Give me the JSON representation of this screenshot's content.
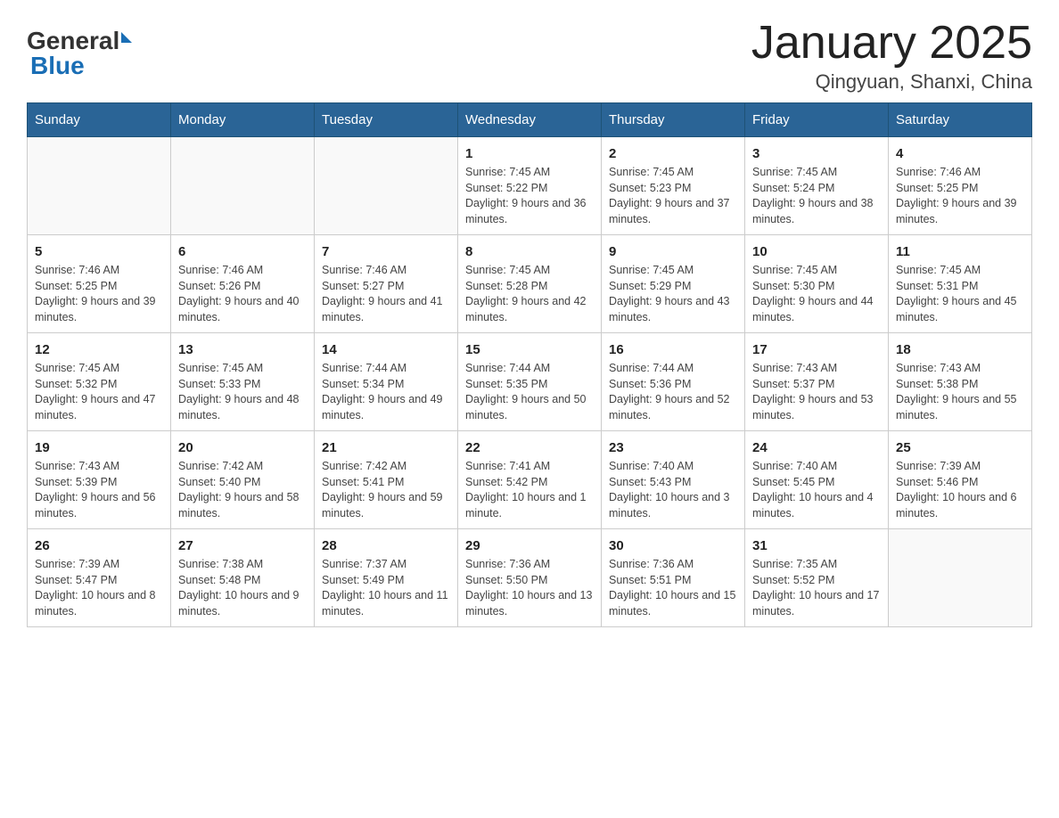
{
  "header": {
    "logo_general": "General",
    "logo_blue": "Blue",
    "month_title": "January 2025",
    "location": "Qingyuan, Shanxi, China"
  },
  "days_of_week": [
    "Sunday",
    "Monday",
    "Tuesday",
    "Wednesday",
    "Thursday",
    "Friday",
    "Saturday"
  ],
  "weeks": [
    [
      {
        "day": "",
        "info": ""
      },
      {
        "day": "",
        "info": ""
      },
      {
        "day": "",
        "info": ""
      },
      {
        "day": "1",
        "info": "Sunrise: 7:45 AM\nSunset: 5:22 PM\nDaylight: 9 hours and 36 minutes."
      },
      {
        "day": "2",
        "info": "Sunrise: 7:45 AM\nSunset: 5:23 PM\nDaylight: 9 hours and 37 minutes."
      },
      {
        "day": "3",
        "info": "Sunrise: 7:45 AM\nSunset: 5:24 PM\nDaylight: 9 hours and 38 minutes."
      },
      {
        "day": "4",
        "info": "Sunrise: 7:46 AM\nSunset: 5:25 PM\nDaylight: 9 hours and 39 minutes."
      }
    ],
    [
      {
        "day": "5",
        "info": "Sunrise: 7:46 AM\nSunset: 5:25 PM\nDaylight: 9 hours and 39 minutes."
      },
      {
        "day": "6",
        "info": "Sunrise: 7:46 AM\nSunset: 5:26 PM\nDaylight: 9 hours and 40 minutes."
      },
      {
        "day": "7",
        "info": "Sunrise: 7:46 AM\nSunset: 5:27 PM\nDaylight: 9 hours and 41 minutes."
      },
      {
        "day": "8",
        "info": "Sunrise: 7:45 AM\nSunset: 5:28 PM\nDaylight: 9 hours and 42 minutes."
      },
      {
        "day": "9",
        "info": "Sunrise: 7:45 AM\nSunset: 5:29 PM\nDaylight: 9 hours and 43 minutes."
      },
      {
        "day": "10",
        "info": "Sunrise: 7:45 AM\nSunset: 5:30 PM\nDaylight: 9 hours and 44 minutes."
      },
      {
        "day": "11",
        "info": "Sunrise: 7:45 AM\nSunset: 5:31 PM\nDaylight: 9 hours and 45 minutes."
      }
    ],
    [
      {
        "day": "12",
        "info": "Sunrise: 7:45 AM\nSunset: 5:32 PM\nDaylight: 9 hours and 47 minutes."
      },
      {
        "day": "13",
        "info": "Sunrise: 7:45 AM\nSunset: 5:33 PM\nDaylight: 9 hours and 48 minutes."
      },
      {
        "day": "14",
        "info": "Sunrise: 7:44 AM\nSunset: 5:34 PM\nDaylight: 9 hours and 49 minutes."
      },
      {
        "day": "15",
        "info": "Sunrise: 7:44 AM\nSunset: 5:35 PM\nDaylight: 9 hours and 50 minutes."
      },
      {
        "day": "16",
        "info": "Sunrise: 7:44 AM\nSunset: 5:36 PM\nDaylight: 9 hours and 52 minutes."
      },
      {
        "day": "17",
        "info": "Sunrise: 7:43 AM\nSunset: 5:37 PM\nDaylight: 9 hours and 53 minutes."
      },
      {
        "day": "18",
        "info": "Sunrise: 7:43 AM\nSunset: 5:38 PM\nDaylight: 9 hours and 55 minutes."
      }
    ],
    [
      {
        "day": "19",
        "info": "Sunrise: 7:43 AM\nSunset: 5:39 PM\nDaylight: 9 hours and 56 minutes."
      },
      {
        "day": "20",
        "info": "Sunrise: 7:42 AM\nSunset: 5:40 PM\nDaylight: 9 hours and 58 minutes."
      },
      {
        "day": "21",
        "info": "Sunrise: 7:42 AM\nSunset: 5:41 PM\nDaylight: 9 hours and 59 minutes."
      },
      {
        "day": "22",
        "info": "Sunrise: 7:41 AM\nSunset: 5:42 PM\nDaylight: 10 hours and 1 minute."
      },
      {
        "day": "23",
        "info": "Sunrise: 7:40 AM\nSunset: 5:43 PM\nDaylight: 10 hours and 3 minutes."
      },
      {
        "day": "24",
        "info": "Sunrise: 7:40 AM\nSunset: 5:45 PM\nDaylight: 10 hours and 4 minutes."
      },
      {
        "day": "25",
        "info": "Sunrise: 7:39 AM\nSunset: 5:46 PM\nDaylight: 10 hours and 6 minutes."
      }
    ],
    [
      {
        "day": "26",
        "info": "Sunrise: 7:39 AM\nSunset: 5:47 PM\nDaylight: 10 hours and 8 minutes."
      },
      {
        "day": "27",
        "info": "Sunrise: 7:38 AM\nSunset: 5:48 PM\nDaylight: 10 hours and 9 minutes."
      },
      {
        "day": "28",
        "info": "Sunrise: 7:37 AM\nSunset: 5:49 PM\nDaylight: 10 hours and 11 minutes."
      },
      {
        "day": "29",
        "info": "Sunrise: 7:36 AM\nSunset: 5:50 PM\nDaylight: 10 hours and 13 minutes."
      },
      {
        "day": "30",
        "info": "Sunrise: 7:36 AM\nSunset: 5:51 PM\nDaylight: 10 hours and 15 minutes."
      },
      {
        "day": "31",
        "info": "Sunrise: 7:35 AM\nSunset: 5:52 PM\nDaylight: 10 hours and 17 minutes."
      },
      {
        "day": "",
        "info": ""
      }
    ]
  ]
}
